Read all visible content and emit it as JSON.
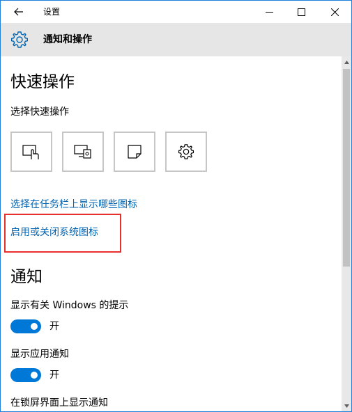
{
  "window": {
    "title": "设置"
  },
  "header": {
    "title": "通知和操作"
  },
  "quick_actions": {
    "section_title": "快速操作",
    "subtitle": "选择快速操作",
    "tiles": [
      {
        "icon": "tablet-mode-icon"
      },
      {
        "icon": "project-icon"
      },
      {
        "icon": "note-icon"
      },
      {
        "icon": "settings-gear-icon"
      }
    ],
    "link_taskbar_icons": "选择在任务栏上显示哪些图标",
    "link_system_icons": "启用或关闭系统图标"
  },
  "notifications": {
    "section_title": "通知",
    "items": [
      {
        "label": "显示有关 Windows 的提示",
        "state": "开"
      },
      {
        "label": "显示应用通知",
        "state": "开"
      },
      {
        "label": "在锁屏界面上显示通知"
      }
    ]
  },
  "colors": {
    "accent": "#0078d7",
    "link": "#0063b1",
    "highlight": "#e7302b",
    "header_bg": "#e6e6e6"
  }
}
